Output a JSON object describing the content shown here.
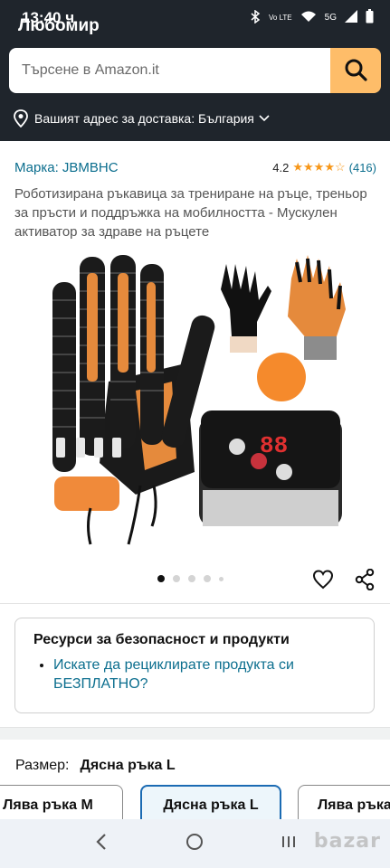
{
  "status_bar": {
    "time": "13:40 ч",
    "user_name": "Любомир",
    "icons": [
      "bluetooth-icon",
      "volte-icon",
      "wifi-icon",
      "signal-5g-icon",
      "battery-icon"
    ],
    "volte_text": "Vo LTE",
    "network_text": "5G"
  },
  "search": {
    "placeholder": "Търсене в Amazon.it"
  },
  "address": {
    "label": "Вашият адрес за доставка: България"
  },
  "product": {
    "brand_label": "Марка: JBMBHC",
    "rating": "4.2",
    "stars": "★★★★☆",
    "rating_count": "(416)",
    "title": "Роботизирана ръкавица за трениране на ръце, треньор за пръсти и поддръжка на мобилността - Мускулен активатор за здраве на ръцете"
  },
  "gallery": {
    "device_display": "88",
    "dot_count": 5
  },
  "resources": {
    "heading": "Ресурси за безопасност и продукти",
    "items": [
      "Искате да рециклирате продукта си БЕЗПЛАТНО?"
    ]
  },
  "size": {
    "label": "Размер:",
    "selected": "Дясна ръка L",
    "options": [
      "Лява ръка M",
      "Дясна ръка L",
      "Лява ръка L"
    ]
  },
  "watermark": "bazar",
  "colors": {
    "header_bg": "#1f252c",
    "search_button": "#febd69",
    "link": "#0b6e8e",
    "star": "#f79719",
    "selected_border": "#1b6bb3"
  }
}
